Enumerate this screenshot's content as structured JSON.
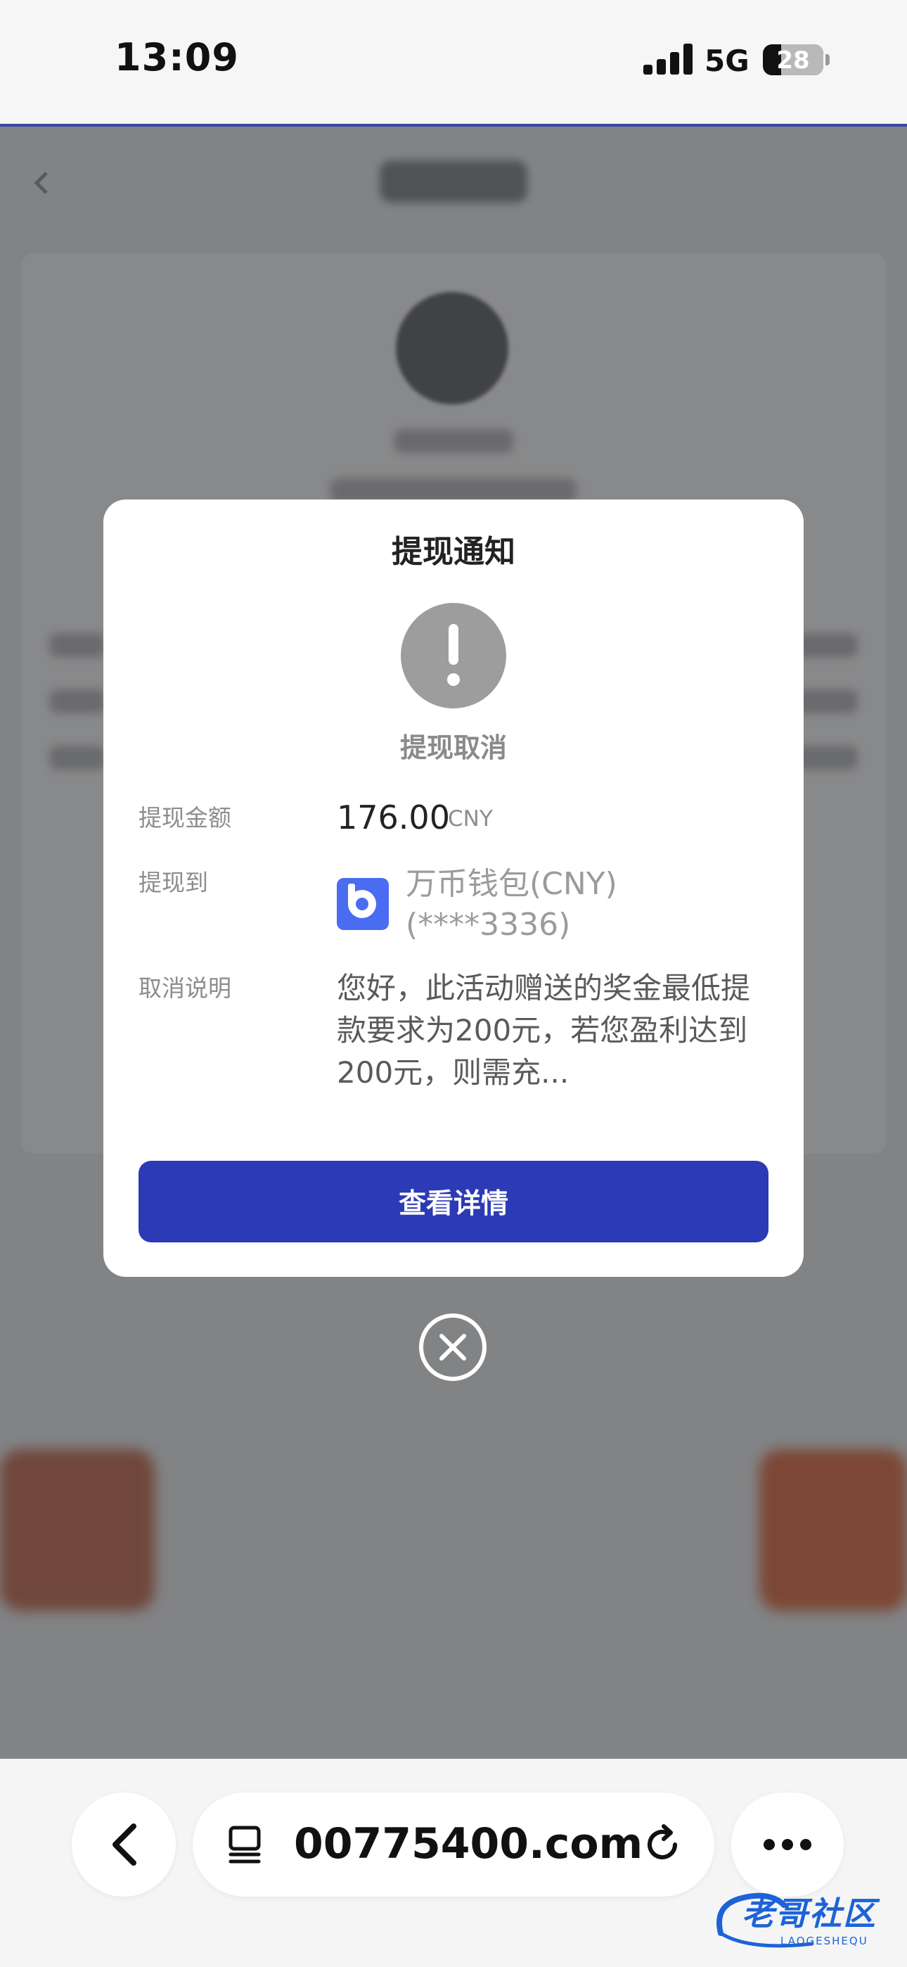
{
  "status_bar": {
    "time": "13:09",
    "network": "5G",
    "battery": "28",
    "icons": [
      "signal-bars-icon",
      "battery-icon"
    ]
  },
  "background_page": {
    "note": "blurred page behind modal",
    "icons": [
      "back-chevron-icon"
    ]
  },
  "modal": {
    "title": "提现通知",
    "status_icon": "exclamation-icon",
    "status_text": "提现取消",
    "rows": {
      "amount_label": "提现金额",
      "amount_value": "176.00",
      "amount_currency": "CNY",
      "to_label": "提现到",
      "wallet_name": "万币钱包(CNY)(****3336)",
      "cancel_label": "取消说明",
      "cancel_text": "您好，此活动赠送的奖金最低提款要求为200元，若您盈利达到200元，则需充..."
    },
    "button_label": "查看详情",
    "close_icon": "close-circle-icon",
    "colors": {
      "button": "#2c3ab5",
      "status_icon": "#9d9d9d",
      "wallet_logo": "#4a6cf0"
    }
  },
  "browser": {
    "url": "00775400.com",
    "icons": [
      "back-icon",
      "tabs-icon",
      "reload-icon",
      "more-icon"
    ]
  },
  "watermark": {
    "text": "老哥社区",
    "sub": "LAOGESHEQU"
  }
}
